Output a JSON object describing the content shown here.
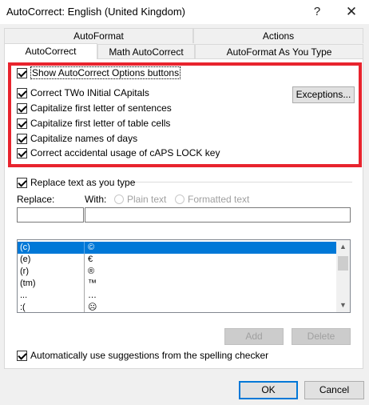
{
  "window": {
    "title": "AutoCorrect: English (United Kingdom)",
    "help_glyph": "?",
    "close_glyph": "✕"
  },
  "tabs": {
    "row_back": [
      "AutoFormat",
      "Actions"
    ],
    "row_front": [
      "AutoCorrect",
      "Math AutoCorrect",
      "AutoFormat As You Type"
    ],
    "active": "AutoCorrect"
  },
  "options": {
    "show_buttons": {
      "label": "Show AutoCorrect Options buttons",
      "checked": true
    },
    "items": [
      {
        "label": "Correct TWo INitial CApitals",
        "checked": true
      },
      {
        "label": "Capitalize first letter of sentences",
        "checked": true
      },
      {
        "label": "Capitalize first letter of table cells",
        "checked": true
      },
      {
        "label": "Capitalize names of days",
        "checked": true
      },
      {
        "label": "Correct accidental usage of cAPS LOCK key",
        "checked": true
      }
    ],
    "exceptions_label": "Exceptions..."
  },
  "replace": {
    "toggle_label": "Replace text as you type",
    "checked": true,
    "replace_label": "Replace:",
    "with_label": "With:",
    "plain_text_label": "Plain text",
    "formatted_text_label": "Formatted text",
    "replace_value": "",
    "with_value": ""
  },
  "list": {
    "rows": [
      {
        "from": "(c)",
        "to": "©",
        "selected": true
      },
      {
        "from": "(e)",
        "to": "€",
        "selected": false
      },
      {
        "from": "(r)",
        "to": "®",
        "selected": false
      },
      {
        "from": "(tm)",
        "to": "™",
        "selected": false
      },
      {
        "from": "...",
        "to": "…",
        "selected": false
      },
      {
        "from": ":(",
        "to": "☹",
        "selected": false
      }
    ]
  },
  "buttons": {
    "add": "Add",
    "delete": "Delete",
    "ok": "OK",
    "cancel": "Cancel"
  },
  "suggestions": {
    "label": "Automatically use suggestions from the spelling checker",
    "checked": true
  },
  "colors": {
    "highlight_border": "#e8242e",
    "selection": "#0078d7"
  }
}
